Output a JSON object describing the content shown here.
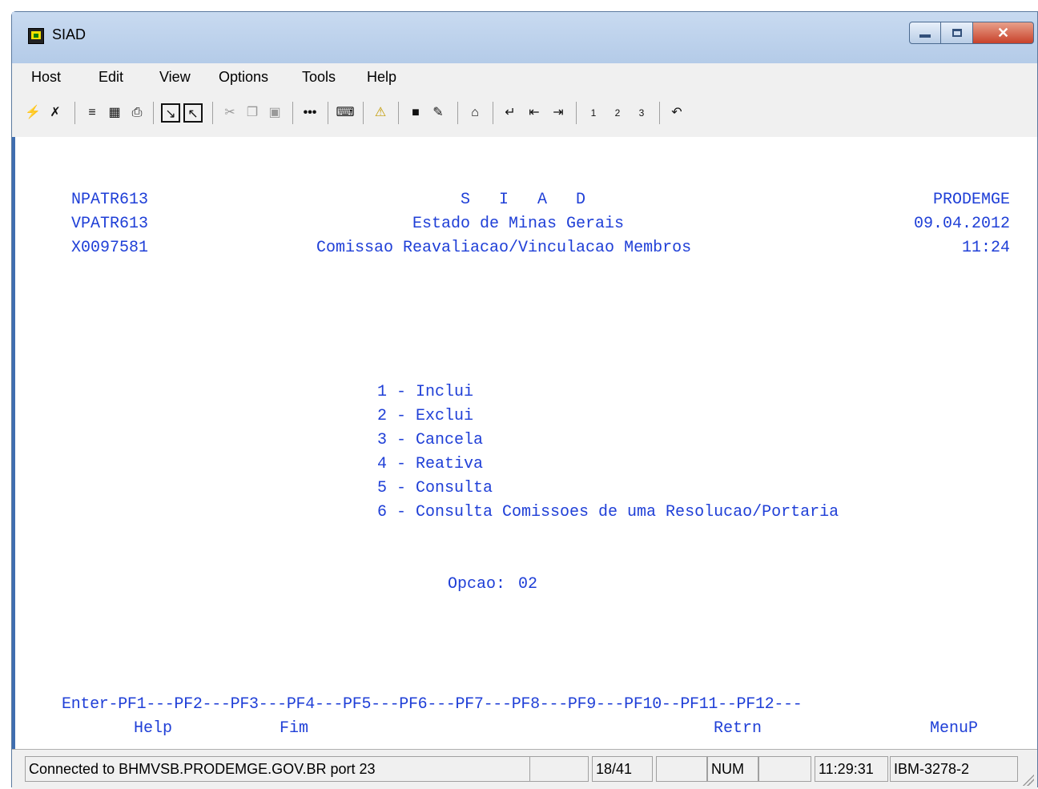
{
  "window": {
    "title": "SIAD"
  },
  "menu": [
    "Host",
    "Edit",
    "View",
    "Options",
    "Tools",
    "Help"
  ],
  "toolbar": {
    "icons": [
      "connect-icon",
      "disconnect-icon",
      "send-icon",
      "receive-icon",
      "print-icon",
      "save-screen-icon",
      "open-screen-icon",
      "cut-icon",
      "copy-icon",
      "paste-icon",
      "dots-icon",
      "keyboard-map-icon",
      "warning-icon",
      "display-icon",
      "pen-icon",
      "home-icon",
      "enter-icon",
      "field-exit-icon",
      "tab-icon",
      "pa1-icon",
      "pa2-icon",
      "pa3-icon",
      "undo-icon"
    ],
    "labels": {
      "pa1": "1",
      "pa2": "2",
      "pa3": "3"
    }
  },
  "screen": {
    "program_id": "NPATR613",
    "view_id": "VPATR613",
    "user_id": "X0097581",
    "app_title": "S   I   A   D",
    "state": "Estado de Minas Gerais",
    "subtitle": "Comissao Reavaliacao/Vinculacao Membros",
    "company": "PRODEMGE",
    "date": "09.04.2012",
    "time": "11:24",
    "options": [
      "1 - Inclui",
      "2 - Exclui",
      "3 - Cancela",
      "4 - Reativa",
      "5 - Consulta",
      "6 - Consulta Comissoes de uma Resolucao/Portaria"
    ],
    "option_label": "Opcao:",
    "option_value": "02",
    "pf_keys_line": "Enter-PF1---PF2---PF3---PF4---PF5---PF6---PF7---PF8---PF9---PF10--PF11--PF12---",
    "pf_labels": {
      "pf1": "Help",
      "pf3": "Fim",
      "pf9": "Retrn",
      "pf12": "MenuP"
    }
  },
  "status": {
    "connection": "Connected to BHMVSB.PRODEMGE.GOV.BR port 23",
    "cursor": "18/41",
    "num": "NUM",
    "clock": "11:29:31",
    "terminal": "IBM-3278-2"
  }
}
